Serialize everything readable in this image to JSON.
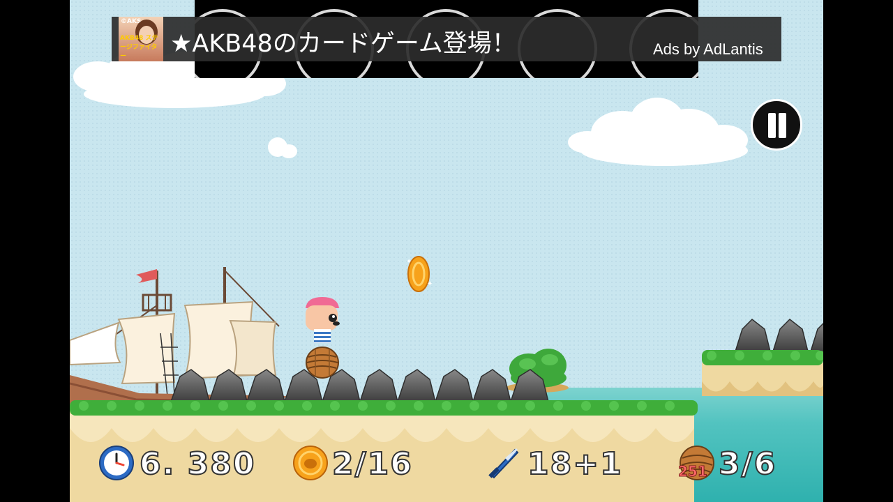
{
  "ad": {
    "title": "★AKB48のカードゲーム登場！",
    "credit": "Ads by AdLantis",
    "thumbnail_copyright": "©AKS",
    "thumbnail_caption": "AKB48 ステージファイター"
  },
  "controls": {
    "pause_icon": "pause-icon"
  },
  "hud": {
    "time": "6. 380",
    "coins": "2/16",
    "swords": "18+1",
    "barrels": "3/6",
    "barrel_badge": "251"
  },
  "colors": {
    "sky": "#c9e6ef",
    "grass": "#3fae3a",
    "sand": "#efd9a1",
    "sea": "#2db0ad",
    "coin": "#f7a21b",
    "pirate_bandana": "#f06a94"
  }
}
